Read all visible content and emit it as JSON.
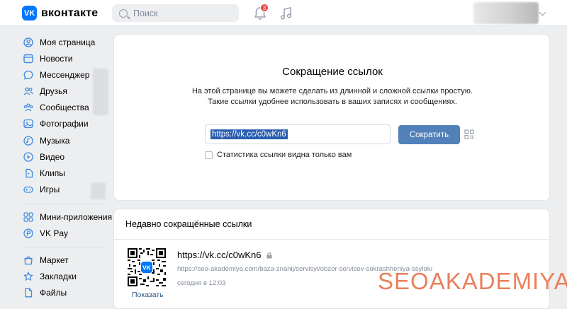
{
  "header": {
    "logo_text": "вконтакте",
    "logo_mark": "VK",
    "search_placeholder": "Поиск",
    "notifications_count": "3"
  },
  "sidebar": {
    "items": [
      {
        "label": "Моя страница",
        "icon": "user-circle-icon"
      },
      {
        "label": "Новости",
        "icon": "newspaper-icon"
      },
      {
        "label": "Мессенджер",
        "icon": "message-icon"
      },
      {
        "label": "Друзья",
        "icon": "users-icon"
      },
      {
        "label": "Сообщества",
        "icon": "communities-icon"
      },
      {
        "label": "Фотографии",
        "icon": "photo-icon"
      },
      {
        "label": "Музыка",
        "icon": "music-icon"
      },
      {
        "label": "Видео",
        "icon": "video-icon"
      },
      {
        "label": "Клипы",
        "icon": "clips-icon"
      },
      {
        "label": "Игры",
        "icon": "gamepad-icon"
      },
      {
        "label": "Мини-приложения",
        "icon": "apps-icon"
      },
      {
        "label": "VK Pay",
        "icon": "vkpay-icon"
      },
      {
        "label": "Маркет",
        "icon": "market-icon"
      },
      {
        "label": "Закладки",
        "icon": "star-icon"
      },
      {
        "label": "Файлы",
        "icon": "file-icon"
      }
    ]
  },
  "shortener": {
    "title": "Сокращение ссылок",
    "description_line1": "На этой странице вы можете сделать из длинной и сложной ссылки простую.",
    "description_line2": "Такие ссылки удобнее использовать в ваших записях и сообщениях.",
    "url_value": "https://vk.cc/c0wKn6",
    "button_label": "Сократить",
    "checkbox_label": "Статистика ссылки видна только вам"
  },
  "recent": {
    "title": "Недавно сокращённые ссылки",
    "items": [
      {
        "short_url": "https://vk.cc/c0wKn6",
        "long_url": "https://seo-akademiya.com/baza-znanij/servisyi/obzor-servisov-sokrashheniya-ssylok/",
        "timestamp": "сегодня в 12:03",
        "show_label": "Показать"
      }
    ]
  },
  "watermark": "SEOAKADEMIYA",
  "colors": {
    "accent": "#0077ff",
    "button": "#5181b8",
    "link": "#2a5885",
    "badge": "#e64646",
    "sidebar_icon": "#3f8ae0"
  }
}
